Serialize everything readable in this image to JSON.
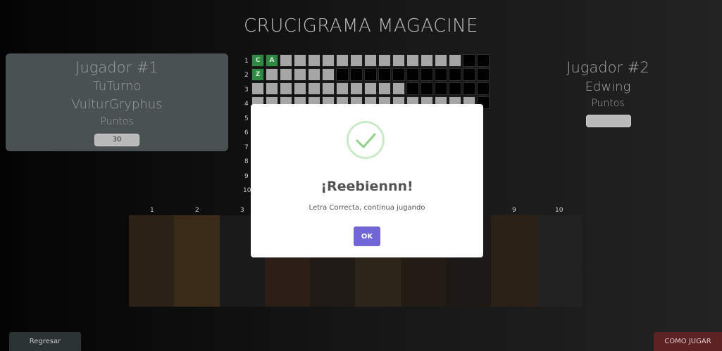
{
  "title": "CRUCIGRAMA MAGACINE",
  "player1": {
    "label": "Jugador #1",
    "name1": "TuTurno",
    "name2": "VulturGryphus",
    "points_label": "Puntos",
    "score": "30"
  },
  "player2": {
    "label": "Jugador #2",
    "name": "Edwing",
    "points_label": "Puntos",
    "score": ""
  },
  "grid": {
    "row_numbers": [
      "1",
      "2",
      "3",
      "4",
      "5",
      "6",
      "7",
      "8",
      "9",
      "10"
    ],
    "letters": [
      "C",
      "A",
      "Z"
    ]
  },
  "column_numbers": [
    "1",
    "2",
    "3",
    "9",
    "10"
  ],
  "modal": {
    "title": "¡Reebiennn!",
    "text": "Letra Correcta, continua jugando",
    "ok_label": "OK"
  },
  "buttons": {
    "back": "Regresar",
    "how_to_play": "COMO JUGAR"
  },
  "colors": {
    "modal_button": "#7066d8",
    "correct_cell": "#2d8a43",
    "check": "#8fd387"
  }
}
